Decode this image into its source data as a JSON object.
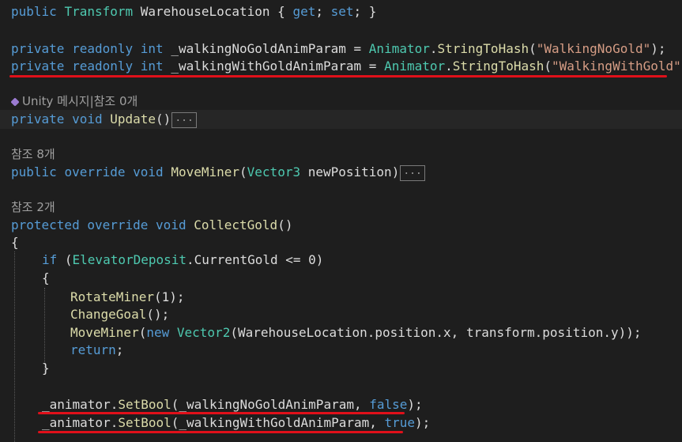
{
  "code": {
    "l1": {
      "kw": "public",
      "type": "Transform",
      "name": "WarehouseLocation",
      "rest": " { ",
      "get": "get",
      "semi1": "; ",
      "set": "set",
      "end": "; }"
    },
    "l2": {
      "kw1": "private",
      "kw2": "readonly",
      "kw3": "int",
      "name": "_walkingNoGoldAnimParam",
      "eq": " = ",
      "cls": "Animator",
      "dot": ".",
      "fn": "StringToHash",
      "open": "(",
      "str": "\"WalkingNoGold\"",
      "close": ");"
    },
    "l3": {
      "kw1": "private",
      "kw2": "readonly",
      "kw3": "int",
      "name": "_walkingWithGoldAnimParam",
      "eq": " = ",
      "cls": "Animator",
      "dot": ".",
      "fn": "StringToHash",
      "open": "(",
      "str": "\"WalkingWithGold\"",
      "close": ");"
    },
    "ref1": {
      "text": "Unity 메시지|참조 0개"
    },
    "l4": {
      "kw1": "private",
      "kw2": "void",
      "fn": "Update",
      "paren": "()",
      "fold": "..."
    },
    "ref2": {
      "text": "참조 8개"
    },
    "l5": {
      "kw1": "public",
      "kw2": "override",
      "kw3": "void",
      "fn": "MoveMiner",
      "open": "(",
      "type": "Vector3",
      "param": " newPosition",
      "close": ")",
      "fold": "..."
    },
    "ref3": {
      "text": "참조 2개"
    },
    "l6": {
      "kw1": "protected",
      "kw2": "override",
      "kw3": "void",
      "fn": "CollectGold",
      "paren": "()"
    },
    "l7": {
      "text": "{"
    },
    "l8": {
      "kw": "if",
      "open": " (",
      "cls": "ElevatorDeposit",
      "dot": ".",
      "prop": "CurrentGold",
      "rest": " <= 0)"
    },
    "l9": {
      "text": "{"
    },
    "l10": {
      "fn": "RotateMiner",
      "rest": "(1);"
    },
    "l11": {
      "fn": "ChangeGoal",
      "rest": "();"
    },
    "l12": {
      "fn": "MoveMiner",
      "open": "(",
      "kw": "new",
      "type": "Vector2",
      "a": "(WarehouseLocation.position.x, transform.position.y));"
    },
    "l13": {
      "kw": "return",
      "rest": ";"
    },
    "l14": {
      "text": "}"
    },
    "l15": {
      "obj": "_animator",
      "dot": ".",
      "fn": "SetBool",
      "a": "(_walkingNoGoldAnimParam, ",
      "val": "false",
      "end": ");"
    },
    "l16": {
      "obj": "_animator",
      "dot": ".",
      "fn": "SetBool",
      "a": "(_walkingWithGoldAnimParam, ",
      "val": "true",
      "end": ");"
    }
  },
  "colors": {
    "keyword": "#569cd6",
    "type": "#4ec9b0",
    "method": "#dcdcaa",
    "string": "#d69d85",
    "underline": "#e0101a"
  }
}
